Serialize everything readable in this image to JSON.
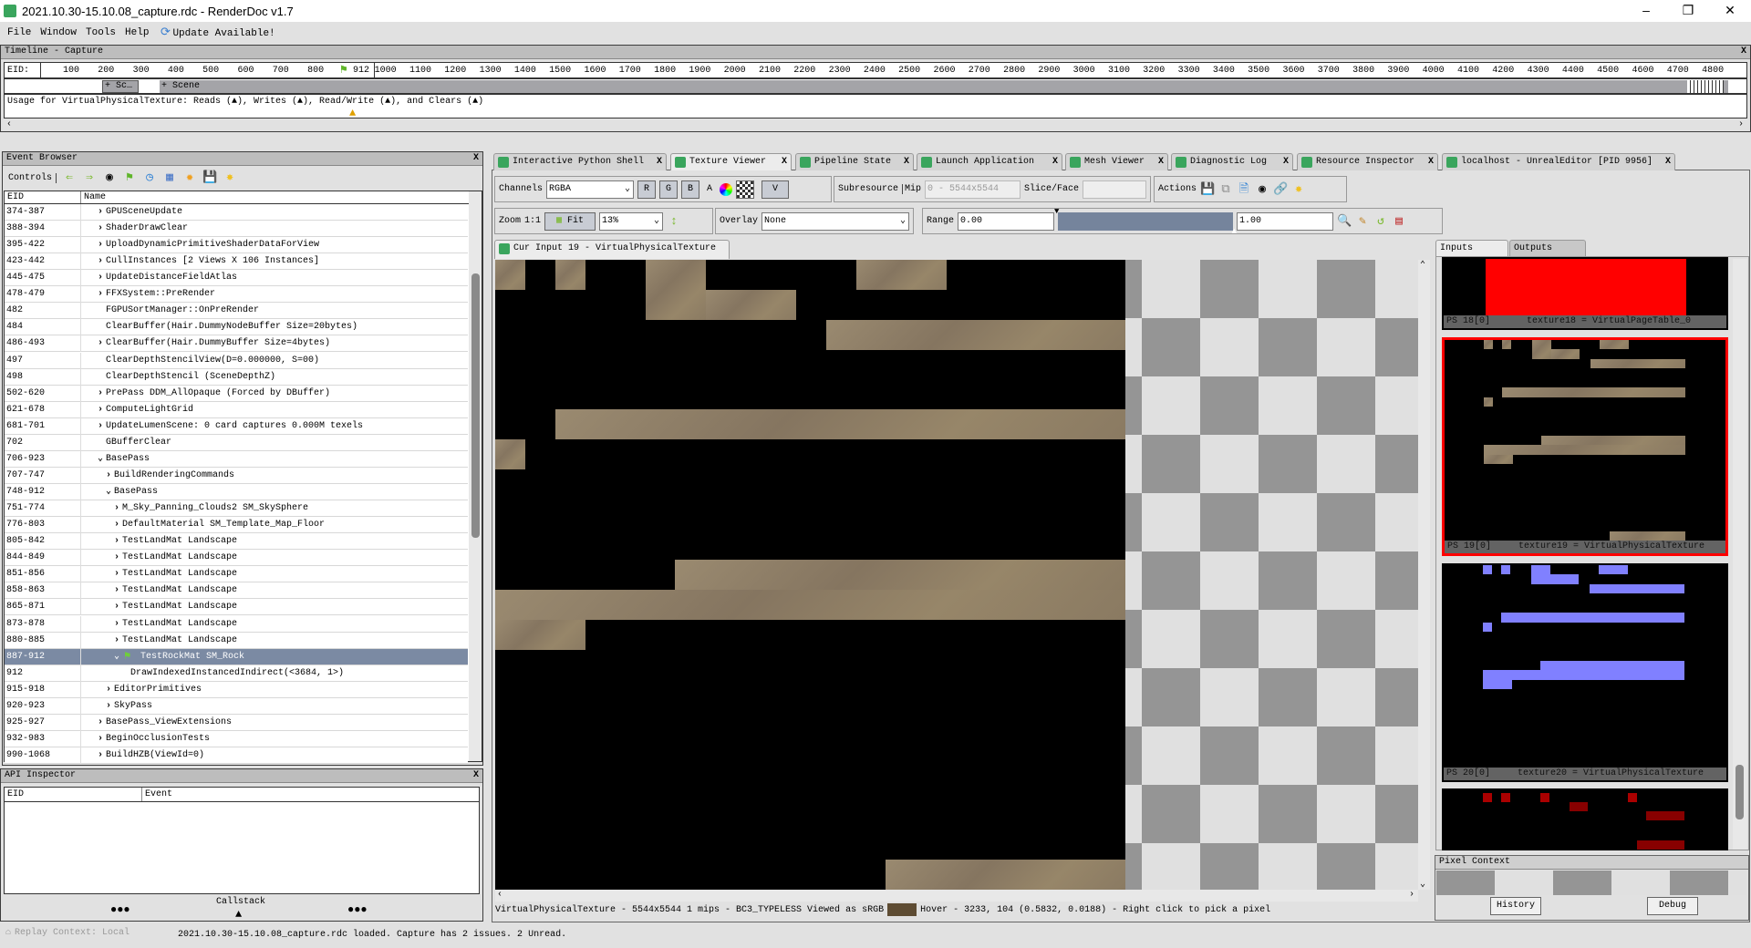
{
  "window": {
    "title": "2021.10.30-15.10.08_capture.rdc - RenderDoc v1.7"
  },
  "menu": [
    "File",
    "Window",
    "Tools",
    "Help"
  ],
  "update": "Update Available!",
  "timeline": {
    "title": "Timeline - Capture",
    "eid_label": "EID:",
    "ticks": [
      100,
      200,
      300,
      400,
      500,
      600,
      700,
      800,
      1000,
      1100,
      1200,
      1300,
      1400,
      1500,
      1600,
      1700,
      1800,
      1900,
      2000,
      2100,
      2200,
      2300,
      2400,
      2500,
      2600,
      2700,
      2800,
      2900,
      3000,
      3100,
      3200,
      3300,
      3400,
      3500,
      3600,
      3700,
      3800,
      3900,
      4000,
      4100,
      4200,
      4300,
      4400,
      4500,
      4600,
      4700,
      4800
    ],
    "current": "912",
    "markers": [
      "+ Sc…",
      "+ Scene"
    ],
    "usage": "Usage for VirtualPhysicalTexture: Reads (▲), Writes (▲), Read/Write (▲), and Clears (▲)"
  },
  "event_browser": {
    "title": "Event Browser",
    "controls": "Controls",
    "col_eid": "EID",
    "col_name": "Name",
    "rows": [
      {
        "eid": "374-387",
        "name": "GPUSceneUpdate",
        "lvl": 0,
        "exp": ">"
      },
      {
        "eid": "388-394",
        "name": "ShaderDrawClear",
        "lvl": 0,
        "exp": ">"
      },
      {
        "eid": "395-422",
        "name": "UploadDynamicPrimitiveShaderDataForView",
        "lvl": 0,
        "exp": ">"
      },
      {
        "eid": "423-442",
        "name": "CullInstances [2 Views X 106 Instances]",
        "lvl": 0,
        "exp": ">"
      },
      {
        "eid": "445-475",
        "name": "UpdateDistanceFieldAtlas",
        "lvl": 0,
        "exp": ">"
      },
      {
        "eid": "478-479",
        "name": "FFXSystem::PreRender",
        "lvl": 0,
        "exp": ">"
      },
      {
        "eid": "482",
        "name": "FGPUSortManager::OnPreRender",
        "lvl": 0,
        "exp": ""
      },
      {
        "eid": "484",
        "name": "ClearBuffer(Hair.DummyNodeBuffer Size=20bytes)",
        "lvl": 0,
        "exp": ""
      },
      {
        "eid": "486-493",
        "name": "ClearBuffer(Hair.DummyBuffer Size=4bytes)",
        "lvl": 0,
        "exp": ">"
      },
      {
        "eid": "497",
        "name": "ClearDepthStencilView(D=0.000000, S=00)",
        "lvl": 0,
        "exp": ""
      },
      {
        "eid": "498",
        "name": "ClearDepthStencil (SceneDepthZ)",
        "lvl": 0,
        "exp": ""
      },
      {
        "eid": "502-620",
        "name": "PrePass DDM_AllOpaque (Forced by DBuffer)",
        "lvl": 0,
        "exp": ">"
      },
      {
        "eid": "621-678",
        "name": "ComputeLightGrid",
        "lvl": 0,
        "exp": ">"
      },
      {
        "eid": "681-701",
        "name": "UpdateLumenScene: 0 card captures 0.000M texels",
        "lvl": 0,
        "exp": ">"
      },
      {
        "eid": "702",
        "name": "GBufferClear",
        "lvl": 0,
        "exp": ""
      },
      {
        "eid": "706-923",
        "name": "BasePass",
        "lvl": 0,
        "exp": "v"
      },
      {
        "eid": "707-747",
        "name": "BuildRenderingCommands",
        "lvl": 1,
        "exp": ">"
      },
      {
        "eid": "748-912",
        "name": "BasePass",
        "lvl": 1,
        "exp": "v"
      },
      {
        "eid": "751-774",
        "name": "M_Sky_Panning_Clouds2 SM_SkySphere",
        "lvl": 2,
        "exp": ">"
      },
      {
        "eid": "776-803",
        "name": "DefaultMaterial SM_Template_Map_Floor",
        "lvl": 2,
        "exp": ">"
      },
      {
        "eid": "805-842",
        "name": "TestLandMat Landscape",
        "lvl": 2,
        "exp": ">"
      },
      {
        "eid": "844-849",
        "name": "TestLandMat Landscape",
        "lvl": 2,
        "exp": ">"
      },
      {
        "eid": "851-856",
        "name": "TestLandMat Landscape",
        "lvl": 2,
        "exp": ">"
      },
      {
        "eid": "858-863",
        "name": "TestLandMat Landscape",
        "lvl": 2,
        "exp": ">"
      },
      {
        "eid": "865-871",
        "name": "TestLandMat Landscape",
        "lvl": 2,
        "exp": ">"
      },
      {
        "eid": "873-878",
        "name": "TestLandMat Landscape",
        "lvl": 2,
        "exp": ">"
      },
      {
        "eid": "880-885",
        "name": "TestLandMat Landscape",
        "lvl": 2,
        "exp": ">"
      },
      {
        "eid": "887-912",
        "name": "TestRockMat SM_Rock",
        "lvl": 2,
        "exp": "v",
        "selected": true,
        "flag": true
      },
      {
        "eid": "912",
        "name": "DrawIndexedInstancedIndirect(<3684, 1>)",
        "lvl": 3,
        "exp": ""
      },
      {
        "eid": "915-918",
        "name": "EditorPrimitives",
        "lvl": 1,
        "exp": ">"
      },
      {
        "eid": "920-923",
        "name": "SkyPass",
        "lvl": 1,
        "exp": ">"
      },
      {
        "eid": "925-927",
        "name": "BasePass_ViewExtensions",
        "lvl": 0,
        "exp": ">"
      },
      {
        "eid": "932-983",
        "name": "BeginOcclusionTests",
        "lvl": 0,
        "exp": ">"
      },
      {
        "eid": "990-1068",
        "name": "BuildHZB(ViewId=0)",
        "lvl": 0,
        "exp": ">"
      }
    ]
  },
  "api_inspector": {
    "title": "API Inspector",
    "col_eid": "EID",
    "col_event": "Event",
    "callstack": "Callstack"
  },
  "status": {
    "replay": "Replay Context: Local",
    "message": "2021.10.30-15.10.08_capture.rdc loaded. Capture has 2 issues. 2 Unread."
  },
  "tabs": [
    "Interactive Python Shell",
    "Texture Viewer",
    "Pipeline State",
    "Launch Application",
    "Mesh Viewer",
    "Diagnostic Log",
    "Resource Inspector",
    "localhost - UnrealEditor [PID 9956]"
  ],
  "toolbar": {
    "channels_label": "Channels",
    "channels": "RGBA",
    "r": "R",
    "g": "G",
    "b": "B",
    "a": "A",
    "v": "V",
    "subresource": "Subresource",
    "mip_label": "Mip",
    "mip": "0 - 5544x5544",
    "slice_label": "Slice/Face",
    "actions": "Actions",
    "zoom_label": "Zoom",
    "one_to_one": "1:1",
    "fit": "Fit",
    "zoom": "13%",
    "overlay_label": "Overlay",
    "overlay": "None",
    "range_label": "Range",
    "range_min": "0.00",
    "range_max": "1.00"
  },
  "viewer": {
    "tab": "Cur Input 19 - VirtualPhysicalTexture",
    "info": "VirtualPhysicalTexture - 5544x5544 1 mips - BC3_TYPELESS Viewed as sRGB",
    "hover": "Hover -  3233,  104 (0.5832, 0.0188)  - Right click to pick a pixel",
    "hover_color": "#5e4c33"
  },
  "side": {
    "inputs": "Inputs",
    "outputs": "Outputs",
    "thumbs": [
      {
        "slot": "PS 18[0]",
        "name": "texture18 = VirtualPageTable_0"
      },
      {
        "slot": "PS 19[0]",
        "name": "texture19 = VirtualPhysicalTexture"
      },
      {
        "slot": "PS 20[0]",
        "name": "texture20 = VirtualPhysicalTexture"
      }
    ],
    "pixel_context": "Pixel Context",
    "history": "History",
    "debug": "Debug"
  }
}
